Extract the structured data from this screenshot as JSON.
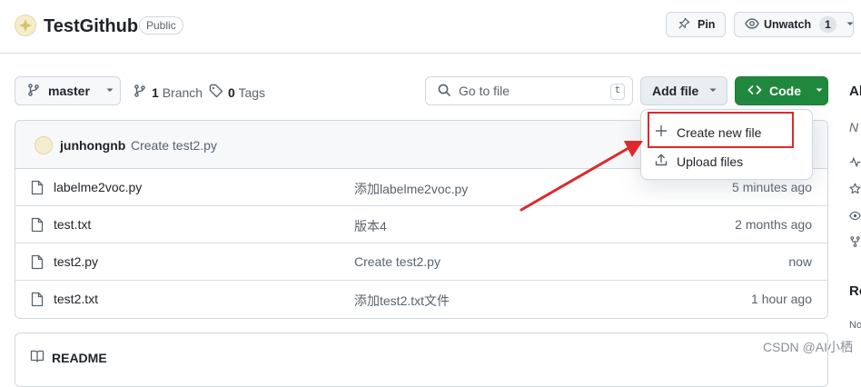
{
  "header": {
    "repo_name": "TestGithub",
    "visibility": "Public",
    "pin_label": "Pin",
    "unwatch_label": "Unwatch",
    "watch_count": "1"
  },
  "toolbar": {
    "branch": "master",
    "branches_count": "1",
    "branches_label": "Branch",
    "tags_count": "0",
    "tags_label": "Tags",
    "search_placeholder": "Go to file",
    "search_shortcut": "t",
    "add_file_label": "Add file",
    "code_label": "Code"
  },
  "commit": {
    "author": "junhongnb",
    "message": "Create test2.py"
  },
  "files": [
    {
      "name": "labelme2voc.py",
      "message": "添加labelme2voc.py",
      "time": "5 minutes ago"
    },
    {
      "name": "test.txt",
      "message": "版本4",
      "time": "2 months ago"
    },
    {
      "name": "test2.py",
      "message": "Create test2.py",
      "time": "now"
    },
    {
      "name": "test2.txt",
      "message": "添加test2.txt文件",
      "time": "1 hour ago"
    }
  ],
  "readme": {
    "label": "README"
  },
  "dropdown": {
    "create_new_file": "Create new file",
    "upload_files": "Upload files"
  },
  "sidebar": {
    "about_fragment": "Al",
    "no_desc_fragment": "N",
    "releases_fragment": "Re",
    "no_releases_fragment": "No"
  },
  "watermark": "CSDN @AI小栖",
  "colors": {
    "code_button": "#1f883d",
    "highlight": "#e0282a",
    "arrow": "#e0282a"
  }
}
